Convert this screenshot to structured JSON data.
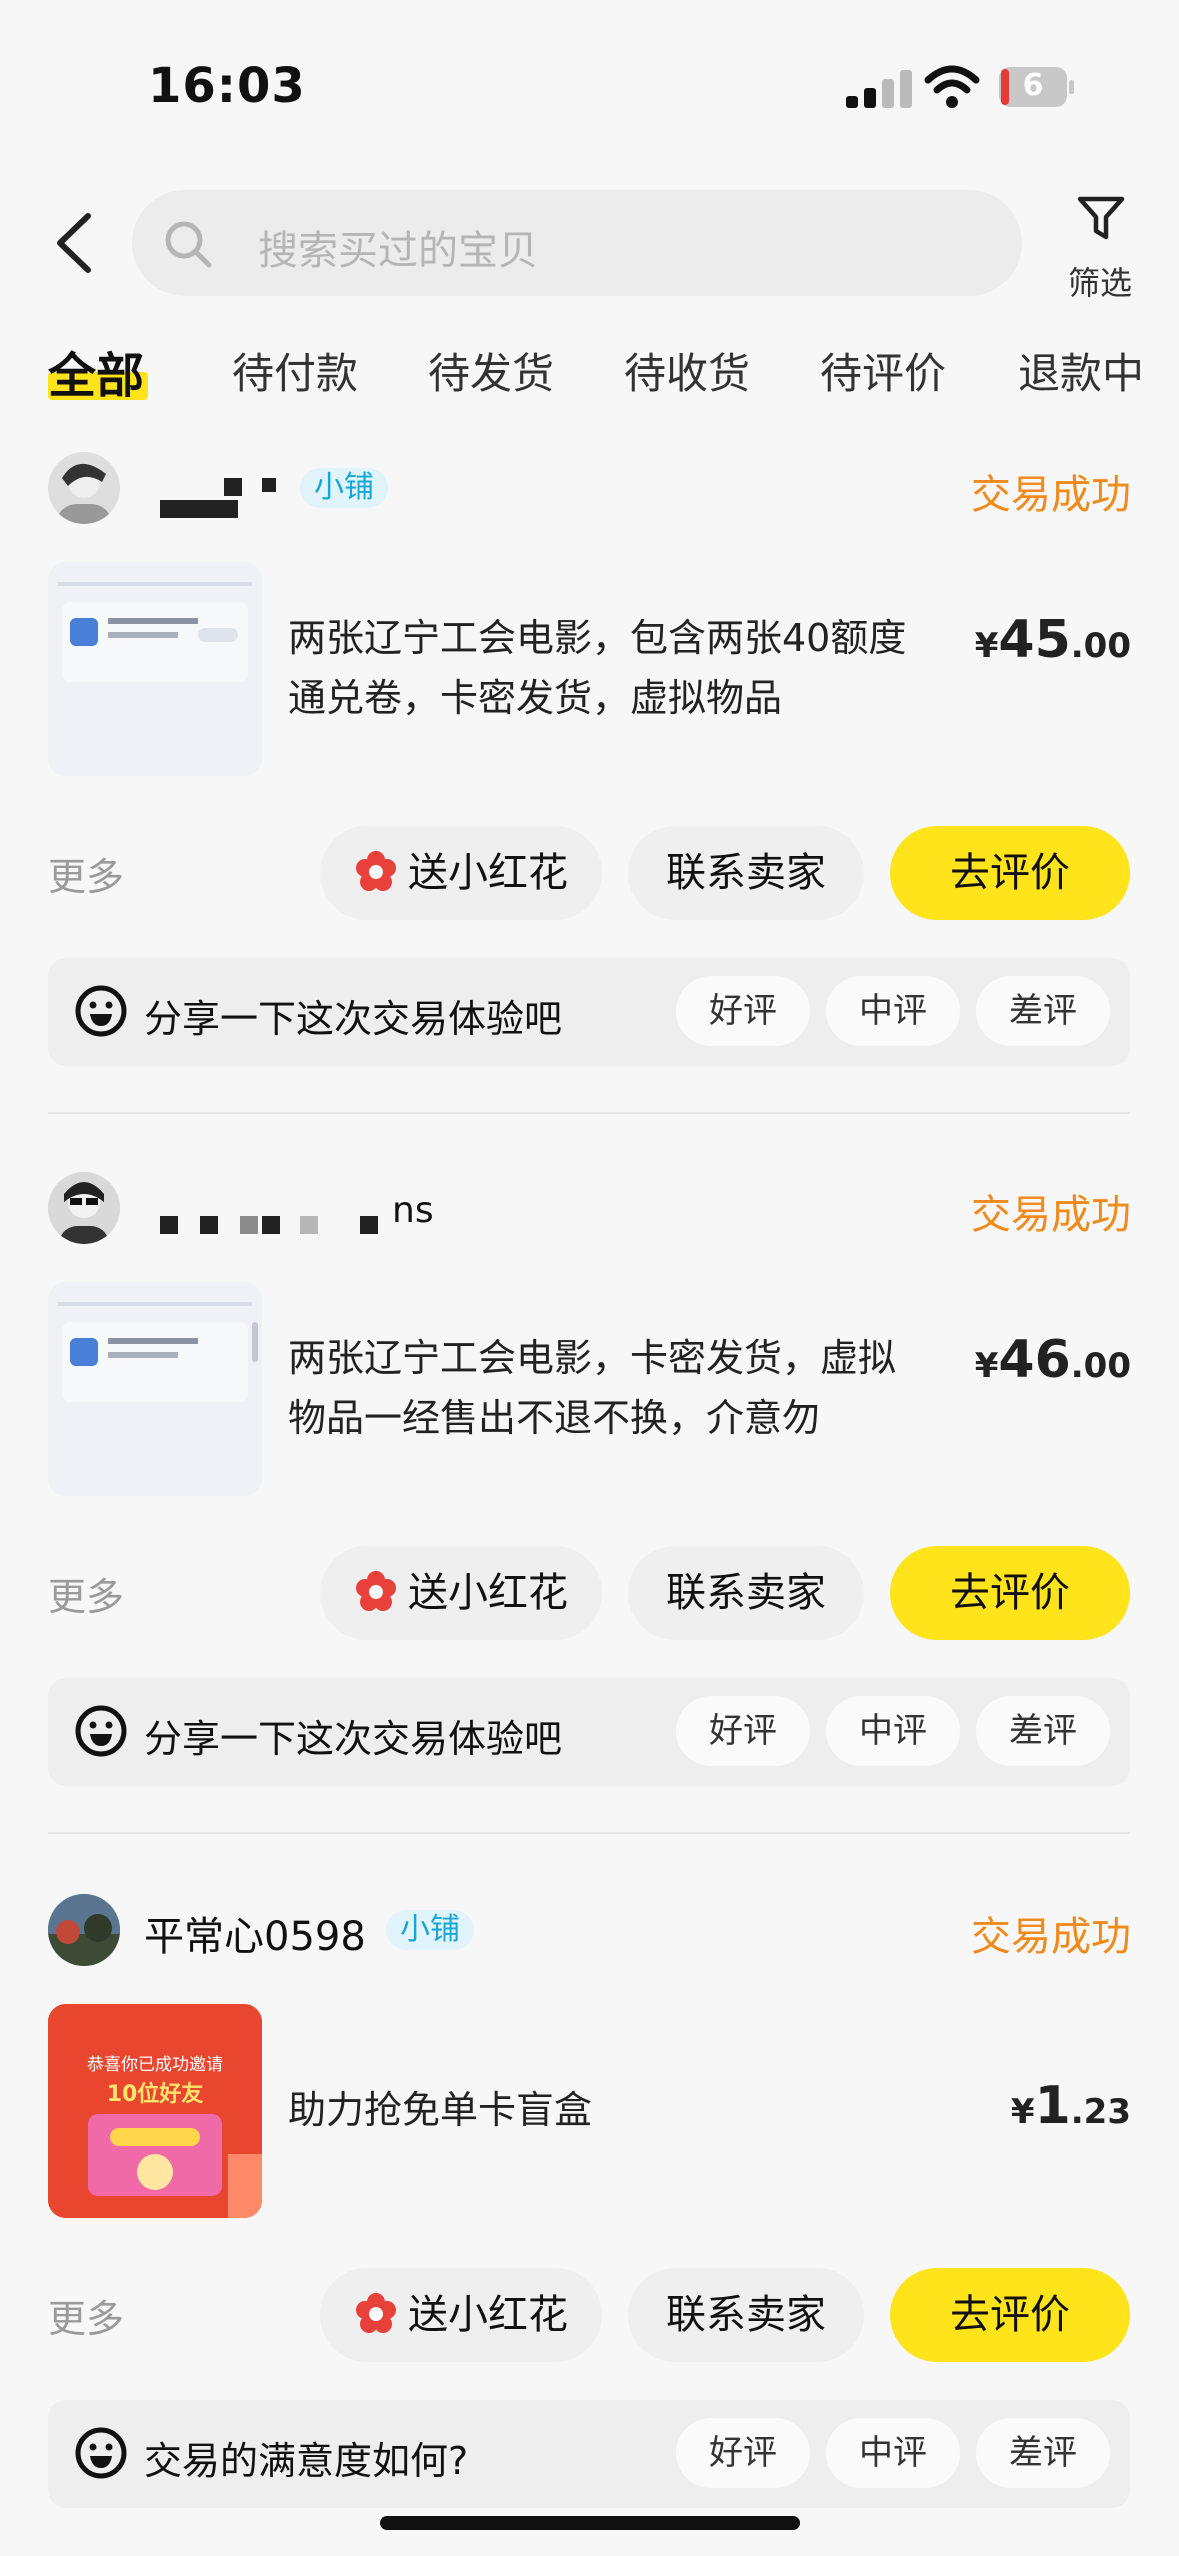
{
  "status_bar": {
    "time": "16:03",
    "battery": "6"
  },
  "header": {
    "search_placeholder": "搜索买过的宝贝",
    "filter_label": "筛选"
  },
  "tabs": [
    "全部",
    "待付款",
    "待发货",
    "待收货",
    "待评价",
    "退款中"
  ],
  "colors": {
    "accent": "#ffe31b",
    "status": "#f08a1a",
    "badge": "#16a6d8"
  },
  "orders": [
    {
      "seller": "",
      "badge": "小铺",
      "status": "交易成功",
      "title": "两张辽宁工会电影，包含两张40额度通兑卷，卡密发货，虚拟物品",
      "price_symbol": "¥",
      "price_int": "45",
      "price_dec": ".00",
      "more": "更多",
      "flower_label": "送小红花",
      "contact_label": "联系卖家",
      "review_label": "去评价",
      "prompt": "分享一下这次交易体验吧",
      "ratings": [
        "好评",
        "中评",
        "差评"
      ]
    },
    {
      "seller": "ns",
      "badge": "",
      "status": "交易成功",
      "title": "两张辽宁工会电影，卡密发货，虚拟物品一经售出不退不换，介意勿",
      "price_symbol": "¥",
      "price_int": "46",
      "price_dec": ".00",
      "more": "更多",
      "flower_label": "送小红花",
      "contact_label": "联系卖家",
      "review_label": "去评价",
      "prompt": "分享一下这次交易体验吧",
      "ratings": [
        "好评",
        "中评",
        "差评"
      ]
    },
    {
      "seller": "平常心0598",
      "badge": "小铺",
      "status": "交易成功",
      "title": "助力抢免单卡盲盒",
      "price_symbol": "¥",
      "price_int": "1",
      "price_dec": ".23",
      "more": "更多",
      "flower_label": "送小红花",
      "contact_label": "联系卖家",
      "review_label": "去评价",
      "prompt": "交易的满意度如何?",
      "ratings": [
        "好评",
        "中评",
        "差评"
      ],
      "thumb_text": [
        "恭喜你已成功邀请",
        "10位好友"
      ]
    }
  ]
}
